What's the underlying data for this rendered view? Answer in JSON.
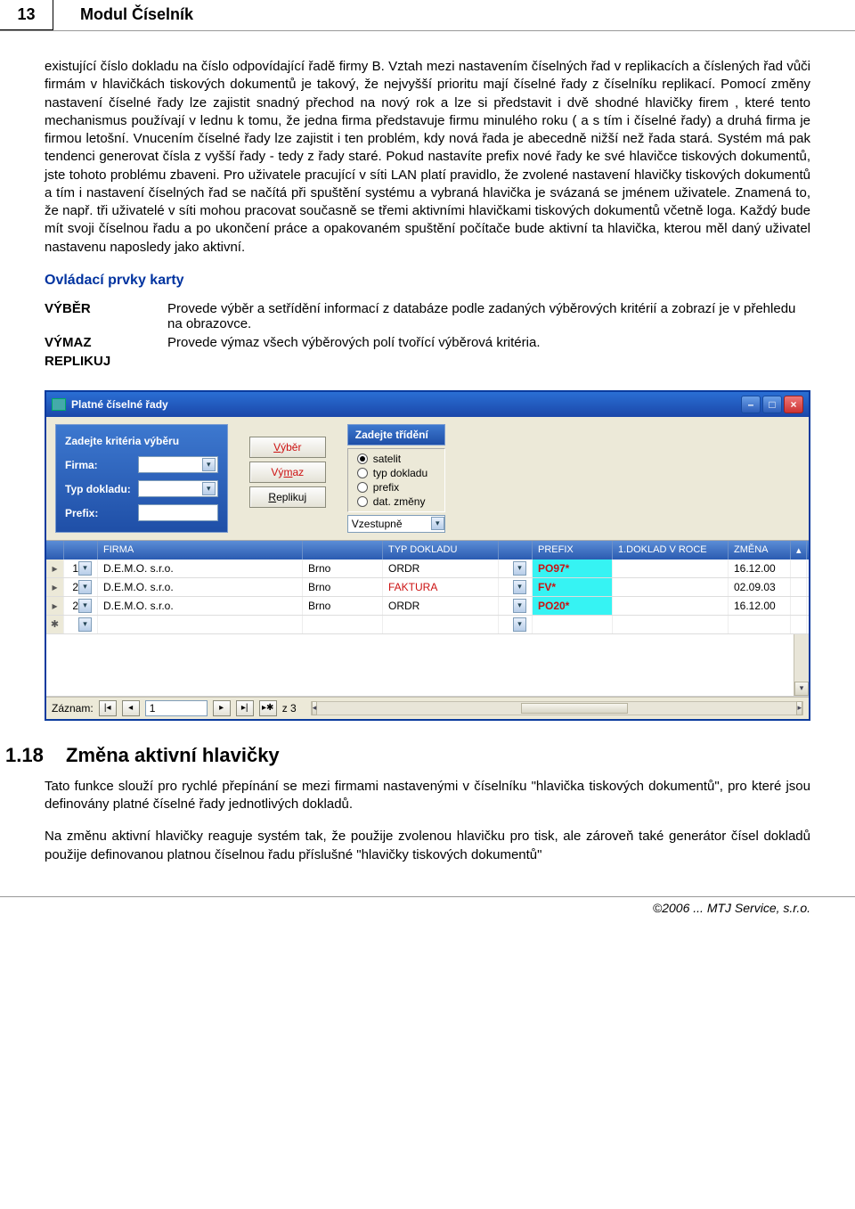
{
  "header": {
    "page_num": "13",
    "title": "Modul Číselník"
  },
  "body": {
    "para1": "existující číslo dokladu na číslo odpovídající řadě firmy B. Vztah mezi nastavením číselných řad v replikacích a číslených řad vůči firmám v hlavičkách tiskových dokumentů je takový, že nejvyšší prioritu mají číselné řady z číselníku replikací. Pomocí změny nastavení číselné řady lze zajistit snadný přechod na nový rok a lze si představit i dvě shodné hlavičky firem , které tento mechanismus používají v lednu k tomu, že jedna firma představuje firmu minulého roku ( a s tím i číselné řady) a druhá firma je firmou letošní. Vnucením číselné řady lze zajistit i ten problém, kdy nová řada je abecedně nižší než řada stará. Systém má pak tendenci generovat čísla z vyšší řady - tedy z řady staré. Pokud nastavíte prefix nové řady ke své hlavičce tiskových dokumentů, jste tohoto problému zbaveni. Pro uživatele pracující v síti LAN platí pravidlo, že zvolené nastavení hlavičky tiskových dokumentů a tím i nastavení číselných řad se načítá při spuštění systému a vybraná hlavička je svázaná se jménem uživatele. Znamená to, že např. tři uživatelé v síti mohou pracovat současně se třemi aktivními hlavičkami tiskových dokumentů včetně loga. Každý bude mít svoji číselnou řadu a po ukončení práce a opakovaném spuštění počítače bude aktivní ta hlavička, kterou měl daný uživatel nastavenu naposledy jako aktivní.",
    "subheading": "Ovládací prvky karty",
    "defs": {
      "t1": "VÝBĚR",
      "d1": "Provede výběr a setřídění informací z databáze podle zadaných výběrových kritérií a zobrazí je v přehledu na obrazovce.",
      "t2": "VÝMAZ",
      "d2": "Provede výmaz všech výběrových polí tvořící výběrová kritéria.",
      "t3": "REPLIKUJ",
      "d3": ""
    }
  },
  "app": {
    "title": "Platné číselné řady",
    "criteria": {
      "heading": "Zadejte kritéria výběru",
      "firma": "Firma:",
      "typ": "Typ dokladu:",
      "prefix": "Prefix:"
    },
    "buttons": {
      "vyber": "Výběr",
      "vymaz": "Výmaz",
      "replikuj": "Replikuj"
    },
    "sort": {
      "heading": "Zadejte třídění",
      "r1": "satelit",
      "r2": "typ dokladu",
      "r3": "prefix",
      "r4": "dat. změny",
      "order": "Vzestupně"
    },
    "columns": {
      "c0": "",
      "c1": "",
      "c2": "FIRMA",
      "c3": "",
      "c4": "TYP DOKLADU",
      "c5": "",
      "c6": "PREFIX",
      "c7": "1.DOKLAD V ROCE",
      "c8": "ZMĚNA",
      "c9": ""
    },
    "rows": [
      {
        "sel": "",
        "n": "1",
        "firma": "D.E.M.O. s.r.o.",
        "misto": "Brno",
        "typ": "ORDR",
        "prefix": "PO97*",
        "doklad": "",
        "zmena": "16.12.00",
        "hl": false
      },
      {
        "sel": "",
        "n": "2",
        "firma": "D.E.M.O. s.r.o.",
        "misto": "Brno",
        "typ": "FAKTURA",
        "prefix": "FV*",
        "doklad": "",
        "zmena": "02.09.03",
        "hl": true
      },
      {
        "sel": "",
        "n": "2",
        "firma": "D.E.M.O. s.r.o.",
        "misto": "Brno",
        "typ": "ORDR",
        "prefix": "PO20*",
        "doklad": "",
        "zmena": "16.12.00",
        "hl": false
      }
    ],
    "nav": {
      "label": "Záznam:",
      "pos": "1",
      "of": "z 3"
    }
  },
  "section2": {
    "num": "1.18",
    "title": "Změna aktivní hlavičky",
    "p1": "Tato funkce slouží pro rychlé přepínání se mezi firmami nastavenými v číselníku \"hlavička tiskových dokumentů\", pro které jsou definovány platné číselné řady jednotlivých dokladů.",
    "p2": "Na změnu aktivní hlavičky reaguje systém tak, že použije zvolenou hlavičku pro tisk, ale zároveň také generátor čísel dokladů použije definovanou platnou číselnou řadu příslušné \"hlavičky tiskových dokumentů\""
  },
  "footer": "©2006 ... MTJ Service, s.r.o."
}
